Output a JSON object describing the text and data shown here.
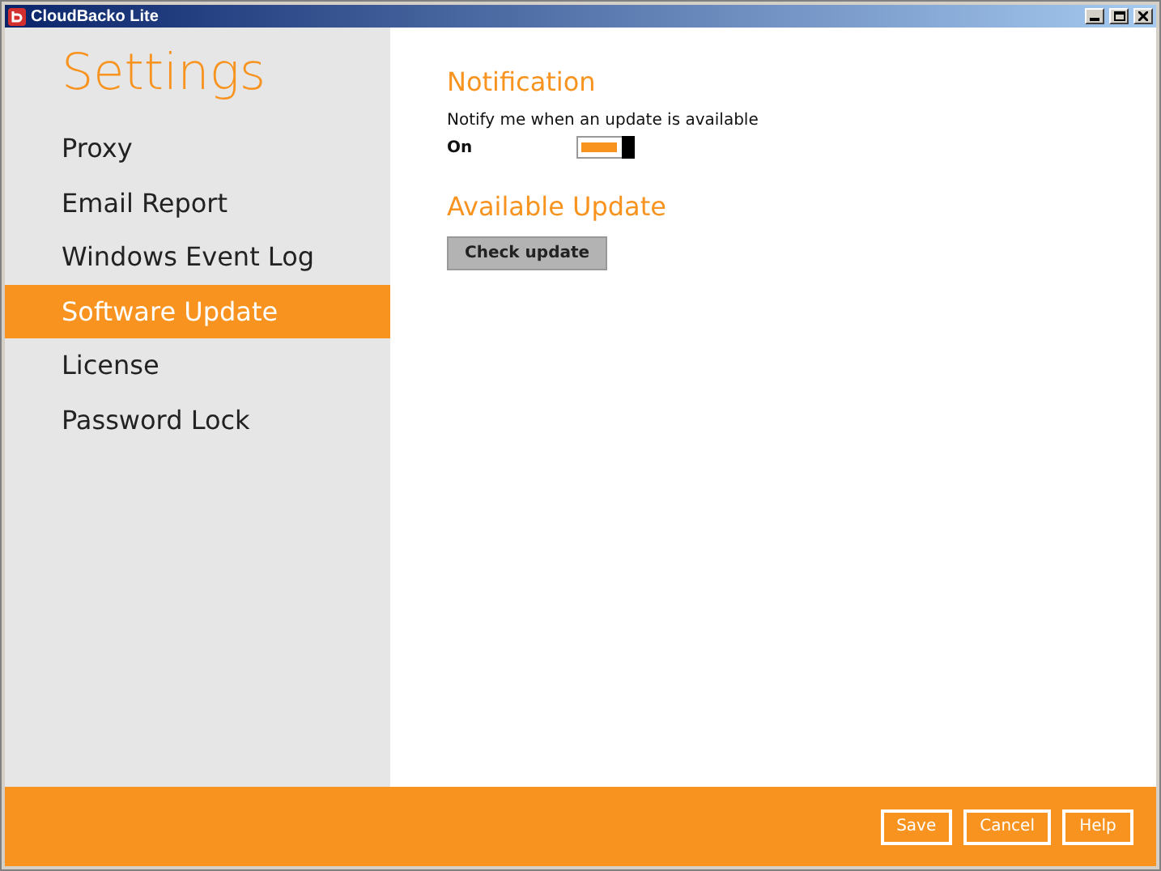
{
  "window": {
    "title": "CloudBacko Lite"
  },
  "sidebar": {
    "title": "Settings",
    "items": [
      {
        "label": "Proxy",
        "selected": false
      },
      {
        "label": "Email Report",
        "selected": false
      },
      {
        "label": "Windows Event Log",
        "selected": false
      },
      {
        "label": "Software Update",
        "selected": true
      },
      {
        "label": "License",
        "selected": false
      },
      {
        "label": "Password Lock",
        "selected": false
      }
    ]
  },
  "notification": {
    "heading": "Notification",
    "label": "Notify me when an update is available",
    "state_text": "On",
    "on": true
  },
  "available_update": {
    "heading": "Available Update",
    "button": "Check update"
  },
  "footer": {
    "buttons": [
      "Save",
      "Cancel",
      "Help"
    ]
  }
}
